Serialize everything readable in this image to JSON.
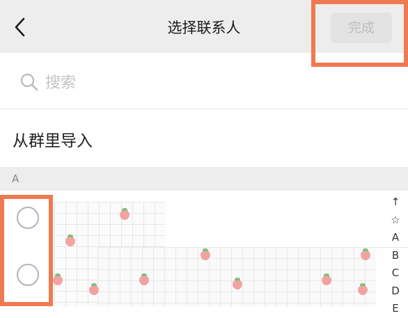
{
  "header": {
    "title": "选择联系人",
    "done_label": "完成",
    "back_icon": "chevron-left-icon"
  },
  "search": {
    "placeholder": "搜索",
    "icon": "search-icon"
  },
  "import_row": {
    "label": "从群里导入"
  },
  "section": {
    "letter": "A"
  },
  "index_bar": {
    "items": [
      "↑",
      "☆",
      "A",
      "B",
      "C",
      "D",
      "E"
    ]
  },
  "colors": {
    "highlight": "#f07a4f",
    "header_bg": "#ededed",
    "done_button_bg": "#e3e3e3",
    "done_button_text": "#bdbdbd"
  }
}
